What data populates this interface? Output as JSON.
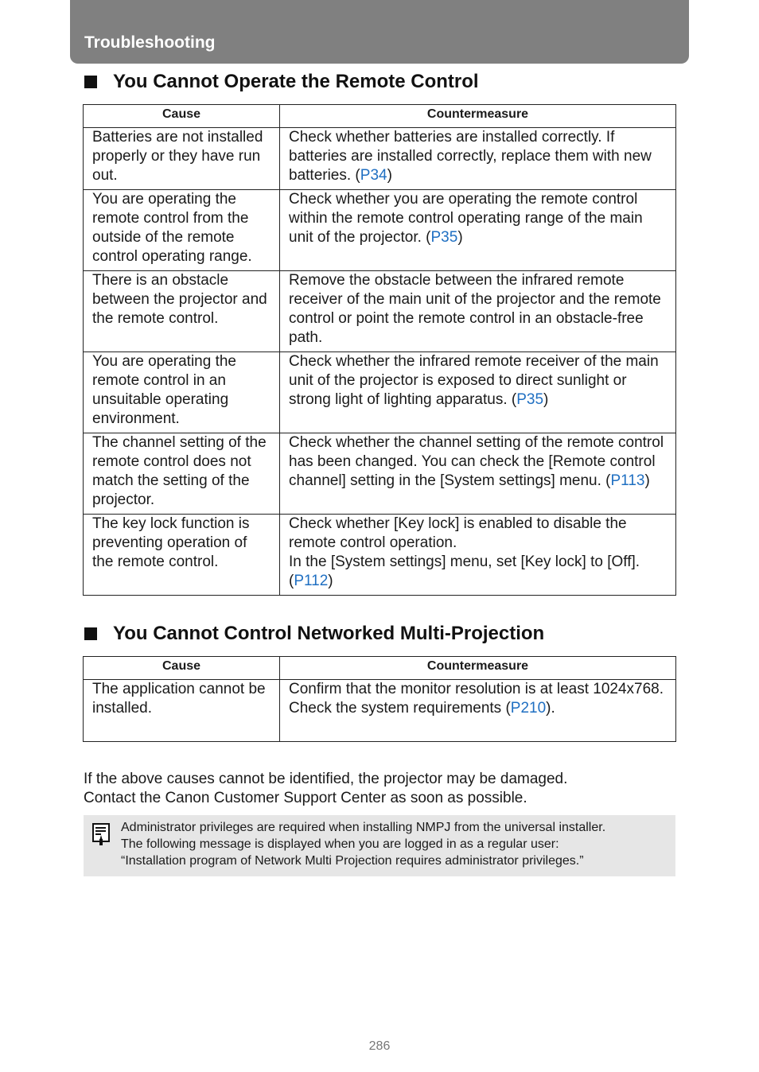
{
  "header": {
    "title": "Troubleshooting"
  },
  "sections": [
    {
      "title": "You Cannot Operate the Remote Control",
      "columns": [
        "Cause",
        "Countermeasure"
      ],
      "rows": [
        {
          "cause": "Batteries are not installed properly or they have run out.",
          "measure": "Check whether batteries are installed correctly. If batteries are installed correctly, replace them with new batteries. (",
          "link": "P34",
          "after": ")"
        },
        {
          "cause": "You are operating the remote control from the outside of the remote control operating range.",
          "measure": "Check whether you are operating the remote control within the remote control operating range of the main unit of the projector. (",
          "link": "P35",
          "after": ")"
        },
        {
          "cause": "There is an obstacle between the projector and the remote control.",
          "measure": "Remove the obstacle between the infrared remote receiver of the main unit of the projector and the remote control or point the remote control in an obstacle-free path.",
          "link": "",
          "after": ""
        },
        {
          "cause": "You are operating the remote control in an unsuitable operating environment.",
          "measure": "Check whether the infrared remote receiver of the main unit of the projector is exposed to direct sunlight or strong light of lighting apparatus. (",
          "link": "P35",
          "after": ")"
        },
        {
          "cause": "The channel setting of the remote control does not match the setting of the projector.",
          "measure": "Check whether the channel setting of the remote control has been changed. You can check the [Remote control channel] setting in the [System settings] menu. (",
          "link": "P113",
          "after": ")"
        },
        {
          "cause": "The key lock function is preventing operation of the remote control.",
          "measure": "Check whether [Key lock] is enabled to disable the remote control operation.\nIn the [System settings] menu, set [Key lock] to [Off]. (",
          "link": "P112",
          "after": ")"
        }
      ]
    },
    {
      "title": "You Cannot Control Networked Multi-Projection",
      "columns": [
        "Cause",
        "Countermeasure"
      ],
      "rows": [
        {
          "cause": "The application cannot be installed.",
          "measure": "Confirm that the monitor resolution is at least 1024x768.\nCheck the system requirements (",
          "link": "P210",
          "after": ")."
        }
      ]
    }
  ],
  "footer_paragraph": {
    "line1": "If the above causes cannot be identified, the projector may be damaged.",
    "line2": "Contact the Canon Customer Support Center as soon as possible."
  },
  "note": {
    "icon": "memo-note-icon",
    "line1": "Administrator privileges are required when installing NMPJ from the universal installer.",
    "line2": "The following message is displayed when you are logged in as a regular user:",
    "line3": "“Installation program of Network Multi Projection requires administrator privileges.”"
  },
  "page_number": "286",
  "colors": {
    "header_bg": "#808080",
    "link": "#1f6fc2",
    "note_bg": "#e6e6e6"
  }
}
